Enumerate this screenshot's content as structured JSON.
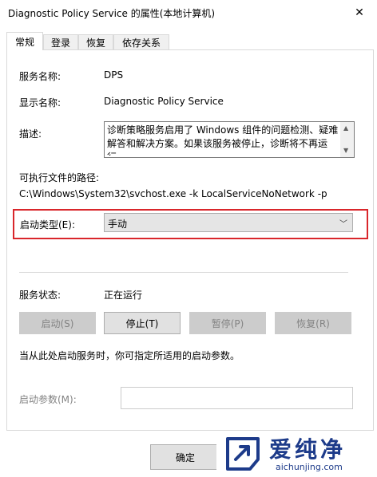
{
  "window": {
    "title": "Diagnostic Policy Service 的属性(本地计算机)",
    "close_glyph": "✕"
  },
  "tabs": [
    {
      "label": "常规",
      "active": true
    },
    {
      "label": "登录",
      "active": false
    },
    {
      "label": "恢复",
      "active": false
    },
    {
      "label": "依存关系",
      "active": false
    }
  ],
  "general": {
    "service_name_label": "服务名称:",
    "service_name": "DPS",
    "display_name_label": "显示名称:",
    "display_name": "Diagnostic Policy Service",
    "description_label": "描述:",
    "description": "诊断策略服务启用了 Windows 组件的问题检测、疑难解答和解决方案。如果该服务被停止，诊断将不再运行。",
    "exe_path_label": "可执行文件的路径:",
    "exe_path": "C:\\Windows\\System32\\svchost.exe -k LocalServiceNoNetwork -p",
    "startup_type_label": "启动类型(E):",
    "startup_type_value": "手动",
    "status_label": "服务状态:",
    "status_value": "正在运行",
    "buttons": {
      "start": "启动(S)",
      "stop": "停止(T)",
      "pause": "暂停(P)",
      "resume": "恢复(R)"
    },
    "hint": "当从此处启动服务时，你可指定所适用的启动参数。",
    "start_params_label": "启动参数(M):",
    "start_params_value": ""
  },
  "footer": {
    "ok_label": "确定"
  },
  "watermark": {
    "cn": "爱纯净",
    "en": "aichunjing.com"
  },
  "colors": {
    "highlight_border": "#d9262b",
    "watermark": "#1d3b8a"
  }
}
